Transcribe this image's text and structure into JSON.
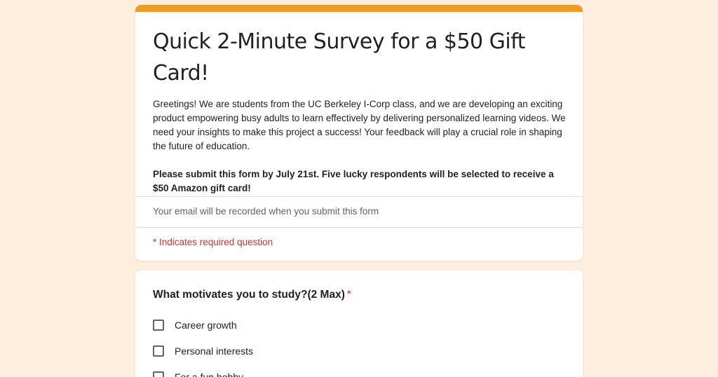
{
  "form": {
    "title": "Quick 2-Minute Survey for a $50 Gift Card!",
    "description": "Greetings! We are students from the UC Berkeley I-Corp class, and we are developing an exciting product empowering busy adults to learn effectively by delivering personalized learning videos. We need your insights to make this project a success! Your feedback will play a crucial role in shaping the future of education.",
    "bold_note": "Please submit this form by July 21st. Five lucky respondents will be selected to receive a $50 Amazon gift card!",
    "email_note": "Your email will be recorded when you submit this form",
    "required_note": "* Indicates required question",
    "accent_color": "#f59a1c"
  },
  "question": {
    "title": "What motivates you to study?(2 Max)",
    "required_mark": "*",
    "options": [
      {
        "label": "Career growth",
        "checked": false
      },
      {
        "label": "Personal interests",
        "checked": false
      },
      {
        "label": "For a fun hobby",
        "checked": false
      }
    ]
  }
}
